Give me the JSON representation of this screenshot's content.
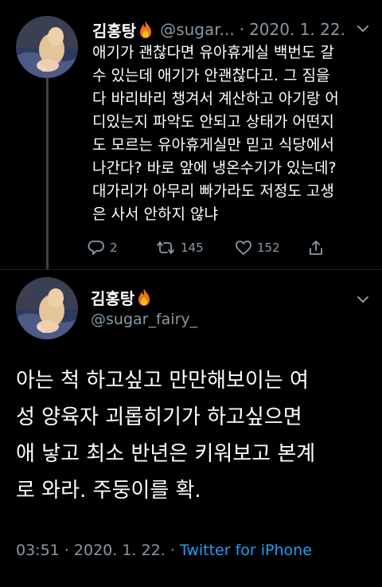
{
  "colors": {
    "background": "#000000",
    "text": "#ffffff",
    "secondary_text": "#8899a6",
    "link": "#1da1f2",
    "thread_line": "#3a444c"
  },
  "tweet1": {
    "author_name": "김홍탕",
    "author_emoji": "fire-icon",
    "handle": "@sugar...",
    "separator": "·",
    "date": "2020. 1. 22.",
    "menu_icon": "chevron-down-icon",
    "lines": [
      "애기가 괜찮다면 유아휴게실 백번도 갈",
      "수 있는데 애기가 안괜찮다고. 그 짐을",
      "다 바리바리 챙겨서 계산하고 아기랑 어",
      "디있는지 파악도 안되고 상태가 어떤지",
      "도 모르는 유아휴게실만 믿고 식당에서",
      "나간다? 바로 앞에 냉온수기가 있는데?",
      "대가리가 아무리 빠가라도 저정도 고생",
      "은 사서 안하지 않냐"
    ],
    "actions": {
      "reply_count": "2",
      "retweet_count": "145",
      "like_count": "152"
    }
  },
  "tweet2": {
    "author_name": "김홍탕",
    "author_emoji": "fire-icon",
    "handle": "@sugar_fairy_",
    "menu_icon": "chevron-down-icon",
    "lines": [
      "아는 척 하고싶고 만만해보이는 여",
      "성 양육자 괴롭히기가 하고싶으면",
      "애 낳고 최소 반년은 키워보고 본계",
      "로 와라. 주둥이를 확."
    ],
    "time": "03:51",
    "separator": "·",
    "date": "2020. 1. 22.",
    "source": "Twitter for iPhone"
  }
}
